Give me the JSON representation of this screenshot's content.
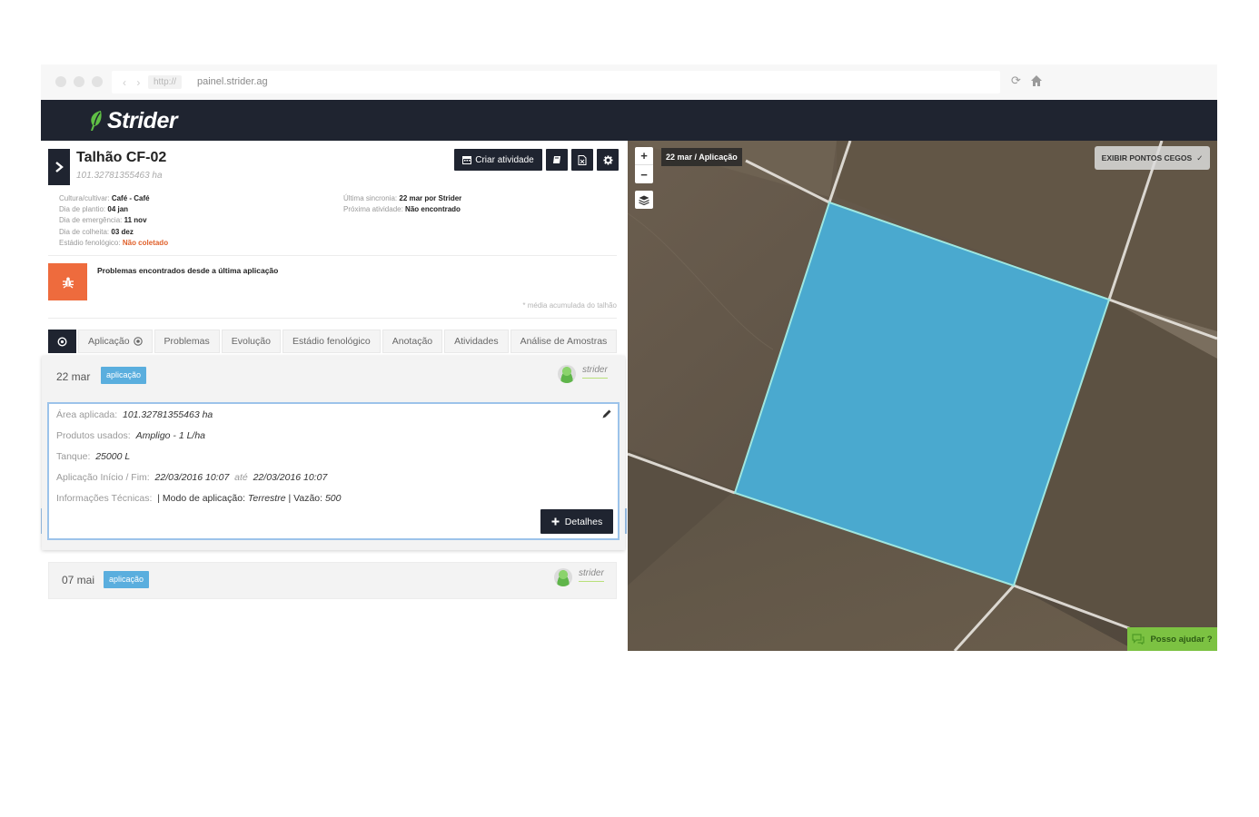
{
  "browser": {
    "url_protocol": "http://",
    "url": "painel.strider.ag",
    "nav_arrows": "‹ ›"
  },
  "header": {
    "logo_text": "Strider"
  },
  "field": {
    "title": "Talhão CF-02",
    "area": "101.32781355463 ha"
  },
  "toolbar": {
    "create_activity_label": "Criar atividade"
  },
  "info_left": [
    {
      "label": "Cultura/cultivar:",
      "value": "Café - Café"
    },
    {
      "label": "Dia de plantio:",
      "value": "04 jan"
    },
    {
      "label": "Dia de emergência:",
      "value": "11 nov"
    },
    {
      "label": "Dia de colheita:",
      "value": "03 dez"
    },
    {
      "label": "Estádio fenológico:",
      "value": "Não coletado"
    }
  ],
  "info_right": [
    {
      "label": "Última sincronia:",
      "value": "22 mar por Strider"
    },
    {
      "label": "Próxima atividade:",
      "value": "Não encontrado"
    }
  ],
  "problems": {
    "text": "Problemas encontrados desde a última aplicação",
    "note": "* média acumulada do talhão"
  },
  "tabs": [
    "Aplicação",
    "Problemas",
    "Evolução",
    "Estádio fenológico",
    "Anotação",
    "Atividades",
    "Análise de Amostras"
  ],
  "activities": [
    {
      "date": "22 mar",
      "badge": "aplicação",
      "user": "strider",
      "details": {
        "area_label": "Área aplicada:",
        "area_value": "101.32781355463 ha",
        "products_label": "Produtos usados:",
        "products_value": "Ampligo - 1 L/ha",
        "tank_label": "Tanque:",
        "tank_value": "25000 L",
        "period_label": "Aplicação Início / Fim:",
        "period_start": "22/03/2016 10:07",
        "period_sep": "até",
        "period_end": "22/03/2016 10:07",
        "tech_label": "Informações Técnicas:",
        "tech_mode_label": "| Modo de aplicação:",
        "tech_mode_value": "Terrestre",
        "tech_flow_label": "| Vazão:",
        "tech_flow_value": "500"
      },
      "details_button": "Detalhes"
    },
    {
      "date": "07 mai",
      "badge": "aplicação",
      "user": "strider"
    }
  ],
  "map": {
    "zoom_in": "+",
    "zoom_out": "−",
    "date_label": "22 mar / Aplicação",
    "blind_spots_label": "EXIBIR PONTOS CEGOS",
    "blind_spots_check": "✓",
    "help_label": "Posso ajudar ?",
    "field_color": "#4aa9cf"
  },
  "colors": {
    "header": "#1f2430",
    "accent_orange": "#ee6b3d",
    "badge_blue": "#5aaede",
    "help_green": "#7cc242"
  }
}
